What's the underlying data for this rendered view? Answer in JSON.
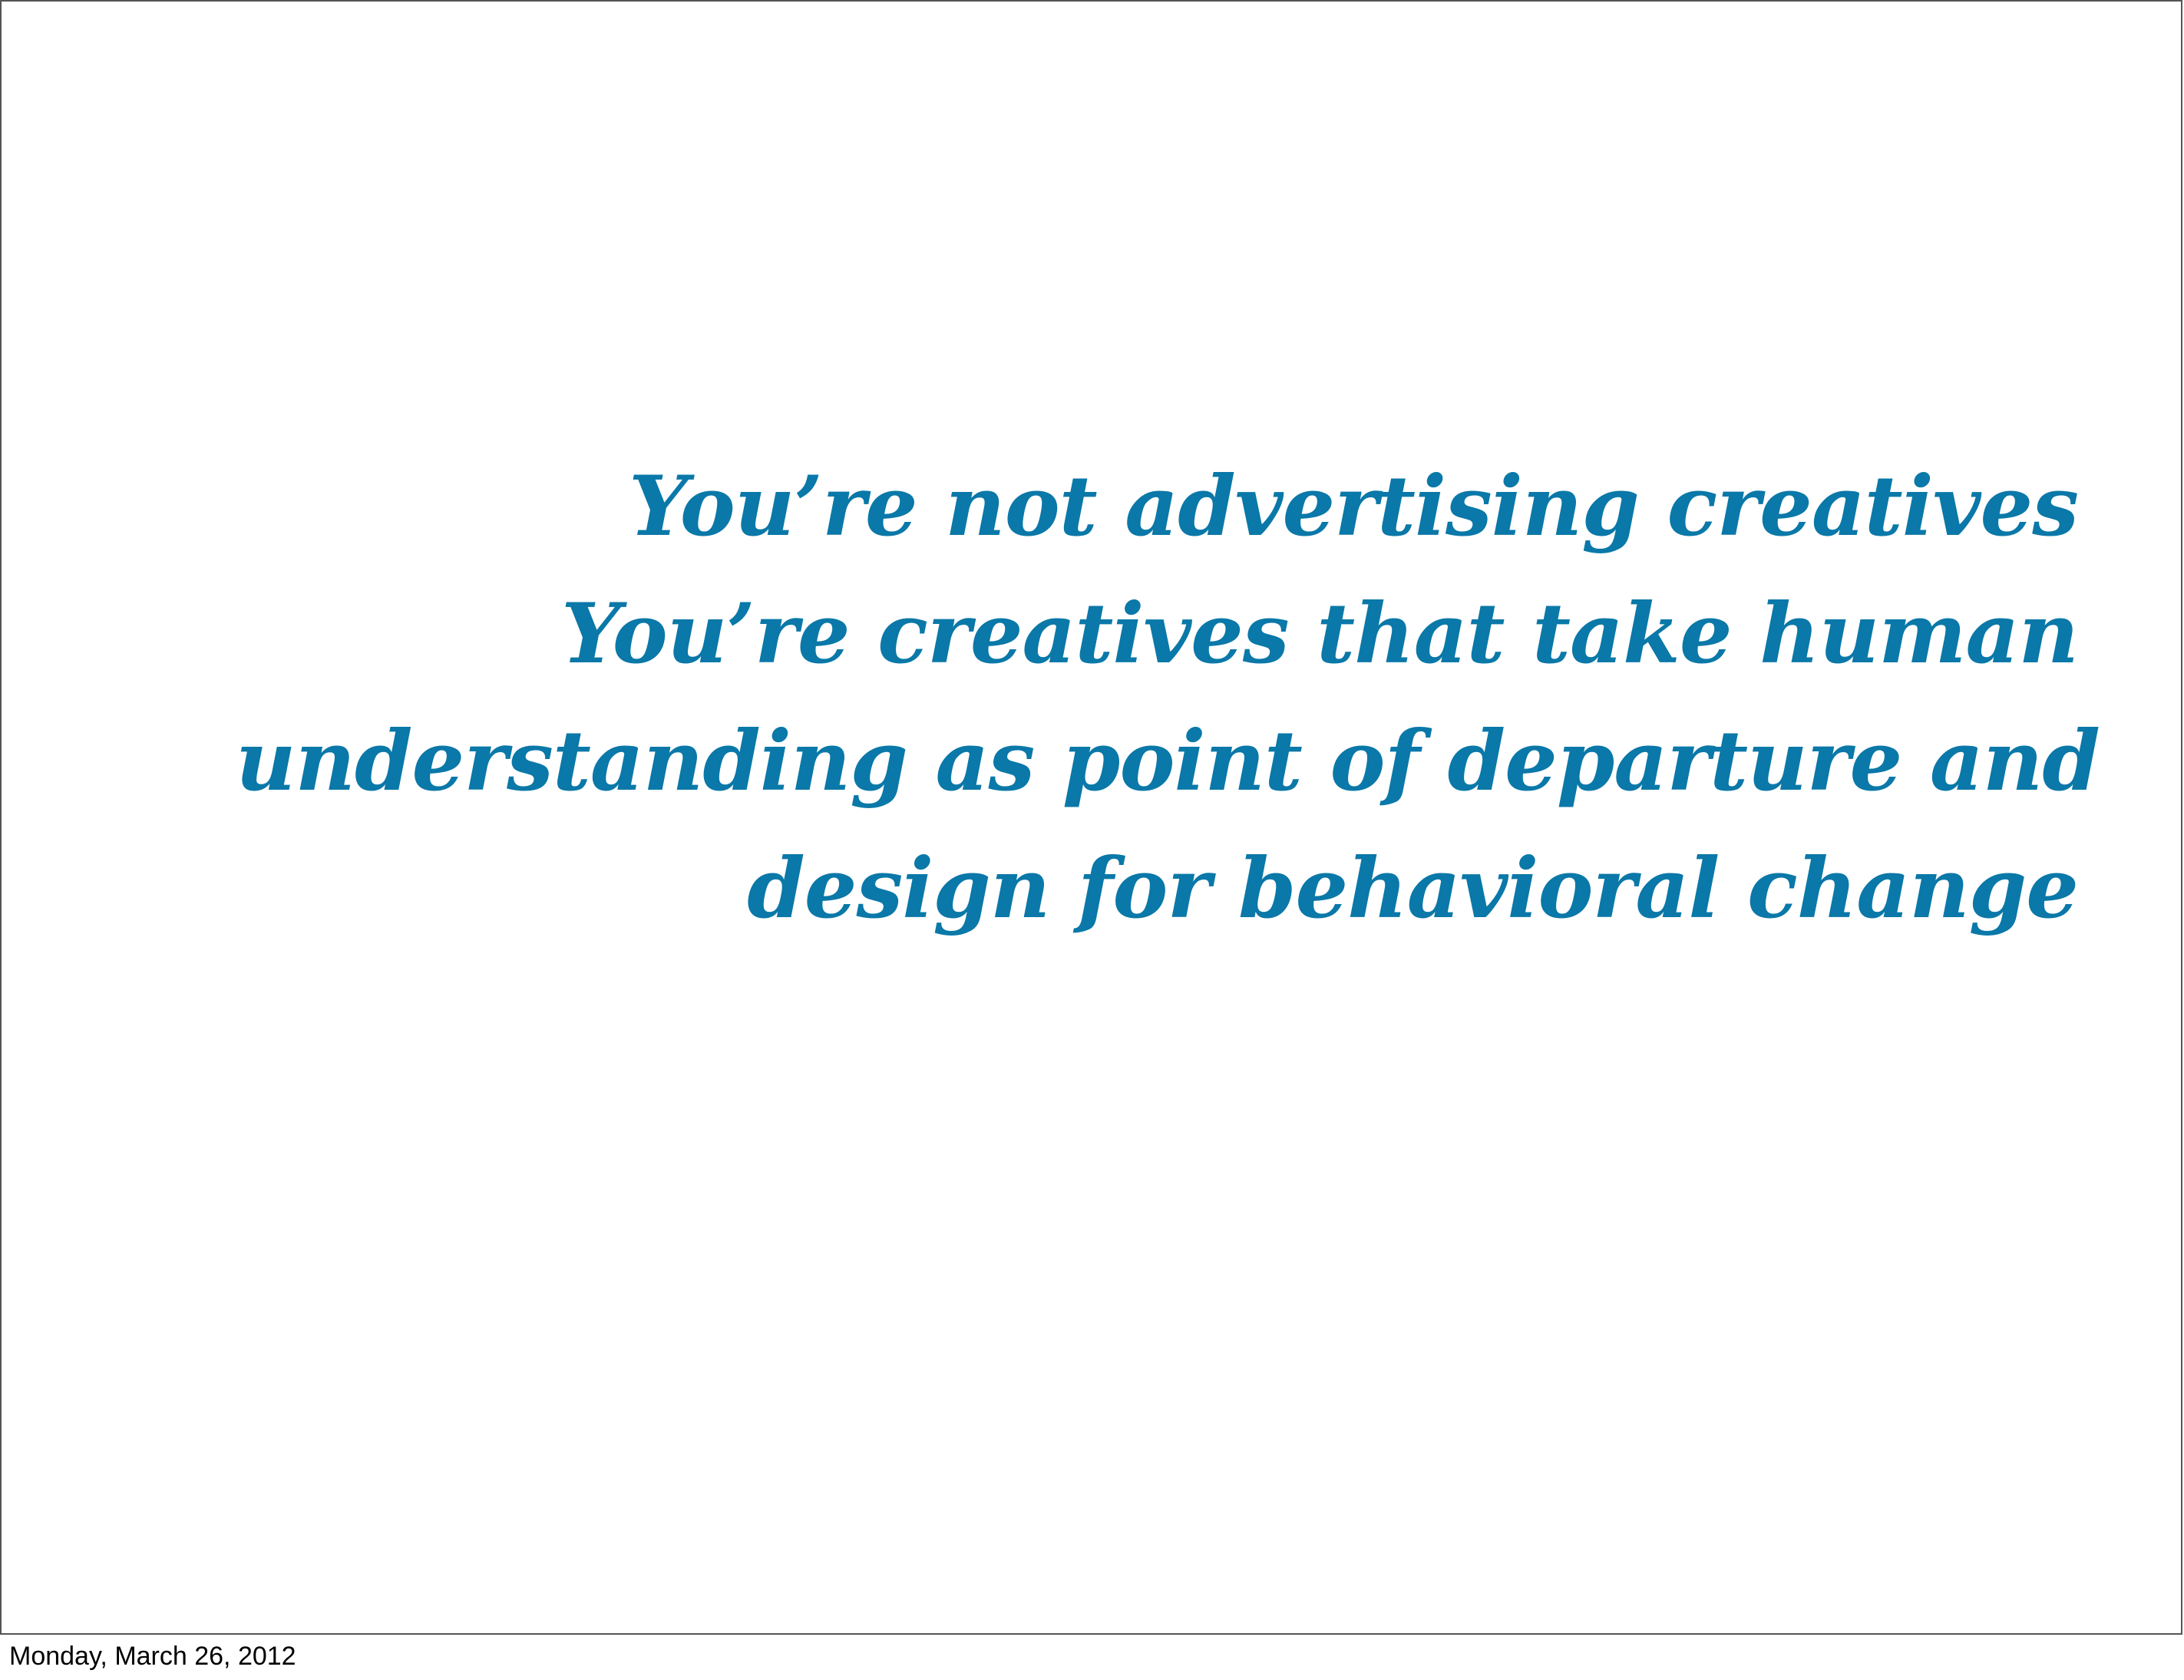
{
  "slide": {
    "quote_lines": [
      "You’re not advertising creatives",
      "You’re creatives that take human",
      "understanding as point of departure and",
      "design for behavioral change"
    ],
    "accent_color": "#0a78a8"
  },
  "footer": {
    "date": "Monday, March 26, 2012"
  }
}
